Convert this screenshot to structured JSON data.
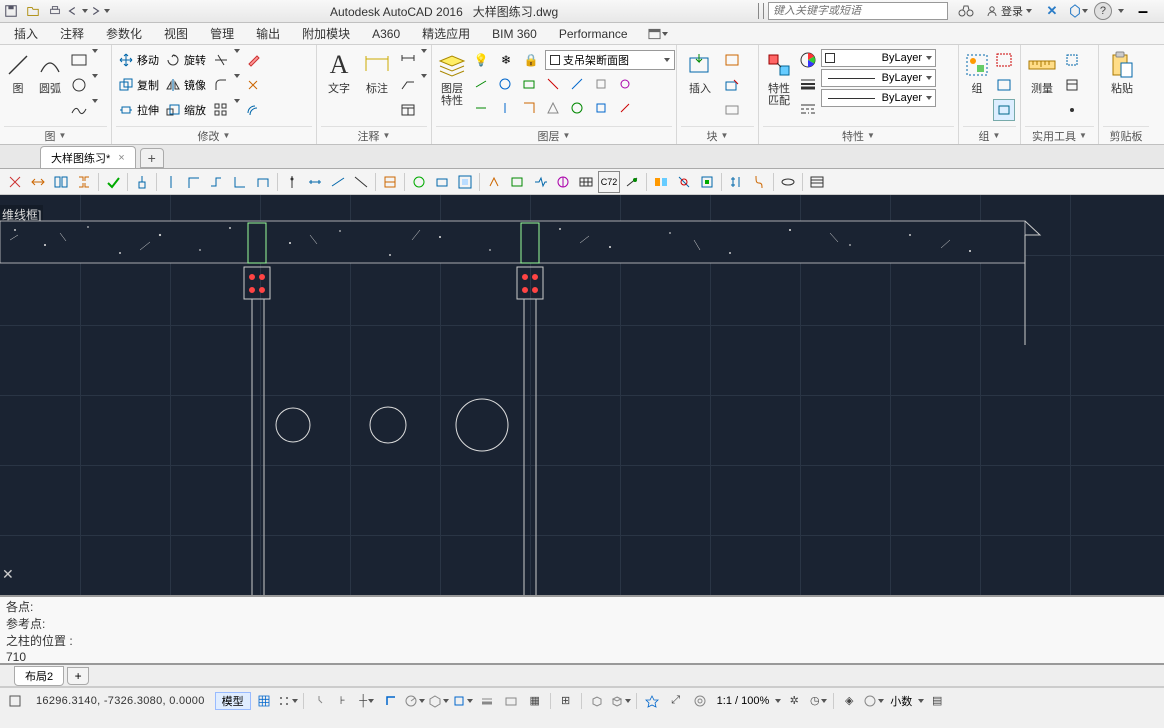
{
  "title": {
    "app": "Autodesk AutoCAD 2016",
    "file": "大样图练习.dwg"
  },
  "search_placeholder": "键入关键字或短语",
  "login_label": "登录",
  "menu": [
    "插入",
    "注释",
    "参数化",
    "视图",
    "管理",
    "输出",
    "附加模块",
    "A360",
    "精选应用",
    "BIM 360",
    "Performance"
  ],
  "ribbon": {
    "draw": {
      "label": "图",
      "arc_label": "圆弧"
    },
    "modify": {
      "label": "修改",
      "move": "移动",
      "rotate": "旋转",
      "copy": "复制",
      "mirror": "镜像",
      "stretch": "拉伸",
      "scale": "缩放"
    },
    "annotate": {
      "label": "注释",
      "text": "文字",
      "dim": "标注"
    },
    "layer": {
      "label": "图层",
      "props": "图层\n特性",
      "current": "支吊架断面图"
    },
    "block": {
      "label": "块",
      "insert": "插入"
    },
    "properties": {
      "label": "特性",
      "match": "特性\n匹配",
      "bylayer": "ByLayer"
    },
    "group": {
      "label": "组",
      "btn": "组"
    },
    "utils": {
      "label": "实用工具",
      "measure": "测量"
    },
    "clipboard": {
      "label": "剪贴板",
      "paste": "粘贴"
    }
  },
  "doc_tab": "大样图练习*",
  "wireframe_label": "维线框]",
  "cmd": {
    "l1": "各点:",
    "l2": "参考点:",
    "l3": "之柱的位置 :",
    "l4": "710"
  },
  "layout_tab": "布局2",
  "status": {
    "coords": "16296.3140, -7326.3080, 0.0000",
    "model": "模型",
    "zoom": "1:1 / 100%",
    "decimal": "小数"
  }
}
